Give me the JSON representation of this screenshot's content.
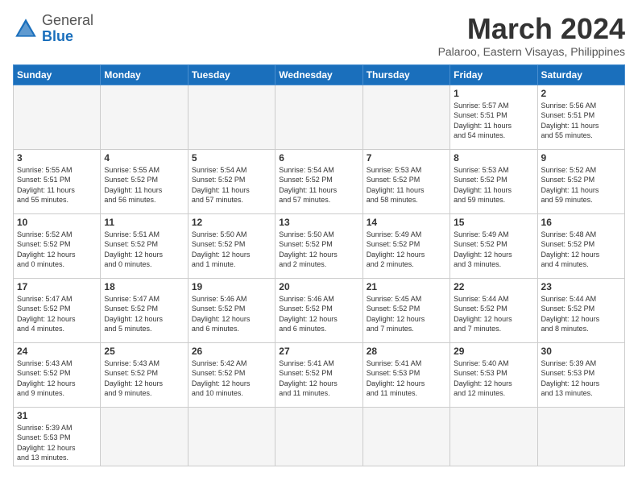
{
  "header": {
    "logo_general": "General",
    "logo_blue": "Blue",
    "title": "March 2024",
    "subtitle": "Palaroo, Eastern Visayas, Philippines"
  },
  "weekdays": [
    "Sunday",
    "Monday",
    "Tuesday",
    "Wednesday",
    "Thursday",
    "Friday",
    "Saturday"
  ],
  "weeks": [
    [
      {
        "day": "",
        "info": ""
      },
      {
        "day": "",
        "info": ""
      },
      {
        "day": "",
        "info": ""
      },
      {
        "day": "",
        "info": ""
      },
      {
        "day": "",
        "info": ""
      },
      {
        "day": "1",
        "info": "Sunrise: 5:57 AM\nSunset: 5:51 PM\nDaylight: 11 hours\nand 54 minutes."
      },
      {
        "day": "2",
        "info": "Sunrise: 5:56 AM\nSunset: 5:51 PM\nDaylight: 11 hours\nand 55 minutes."
      }
    ],
    [
      {
        "day": "3",
        "info": "Sunrise: 5:55 AM\nSunset: 5:51 PM\nDaylight: 11 hours\nand 55 minutes."
      },
      {
        "day": "4",
        "info": "Sunrise: 5:55 AM\nSunset: 5:52 PM\nDaylight: 11 hours\nand 56 minutes."
      },
      {
        "day": "5",
        "info": "Sunrise: 5:54 AM\nSunset: 5:52 PM\nDaylight: 11 hours\nand 57 minutes."
      },
      {
        "day": "6",
        "info": "Sunrise: 5:54 AM\nSunset: 5:52 PM\nDaylight: 11 hours\nand 57 minutes."
      },
      {
        "day": "7",
        "info": "Sunrise: 5:53 AM\nSunset: 5:52 PM\nDaylight: 11 hours\nand 58 minutes."
      },
      {
        "day": "8",
        "info": "Sunrise: 5:53 AM\nSunset: 5:52 PM\nDaylight: 11 hours\nand 59 minutes."
      },
      {
        "day": "9",
        "info": "Sunrise: 5:52 AM\nSunset: 5:52 PM\nDaylight: 11 hours\nand 59 minutes."
      }
    ],
    [
      {
        "day": "10",
        "info": "Sunrise: 5:52 AM\nSunset: 5:52 PM\nDaylight: 12 hours\nand 0 minutes."
      },
      {
        "day": "11",
        "info": "Sunrise: 5:51 AM\nSunset: 5:52 PM\nDaylight: 12 hours\nand 0 minutes."
      },
      {
        "day": "12",
        "info": "Sunrise: 5:50 AM\nSunset: 5:52 PM\nDaylight: 12 hours\nand 1 minute."
      },
      {
        "day": "13",
        "info": "Sunrise: 5:50 AM\nSunset: 5:52 PM\nDaylight: 12 hours\nand 2 minutes."
      },
      {
        "day": "14",
        "info": "Sunrise: 5:49 AM\nSunset: 5:52 PM\nDaylight: 12 hours\nand 2 minutes."
      },
      {
        "day": "15",
        "info": "Sunrise: 5:49 AM\nSunset: 5:52 PM\nDaylight: 12 hours\nand 3 minutes."
      },
      {
        "day": "16",
        "info": "Sunrise: 5:48 AM\nSunset: 5:52 PM\nDaylight: 12 hours\nand 4 minutes."
      }
    ],
    [
      {
        "day": "17",
        "info": "Sunrise: 5:47 AM\nSunset: 5:52 PM\nDaylight: 12 hours\nand 4 minutes."
      },
      {
        "day": "18",
        "info": "Sunrise: 5:47 AM\nSunset: 5:52 PM\nDaylight: 12 hours\nand 5 minutes."
      },
      {
        "day": "19",
        "info": "Sunrise: 5:46 AM\nSunset: 5:52 PM\nDaylight: 12 hours\nand 6 minutes."
      },
      {
        "day": "20",
        "info": "Sunrise: 5:46 AM\nSunset: 5:52 PM\nDaylight: 12 hours\nand 6 minutes."
      },
      {
        "day": "21",
        "info": "Sunrise: 5:45 AM\nSunset: 5:52 PM\nDaylight: 12 hours\nand 7 minutes."
      },
      {
        "day": "22",
        "info": "Sunrise: 5:44 AM\nSunset: 5:52 PM\nDaylight: 12 hours\nand 7 minutes."
      },
      {
        "day": "23",
        "info": "Sunrise: 5:44 AM\nSunset: 5:52 PM\nDaylight: 12 hours\nand 8 minutes."
      }
    ],
    [
      {
        "day": "24",
        "info": "Sunrise: 5:43 AM\nSunset: 5:52 PM\nDaylight: 12 hours\nand 9 minutes."
      },
      {
        "day": "25",
        "info": "Sunrise: 5:43 AM\nSunset: 5:52 PM\nDaylight: 12 hours\nand 9 minutes."
      },
      {
        "day": "26",
        "info": "Sunrise: 5:42 AM\nSunset: 5:52 PM\nDaylight: 12 hours\nand 10 minutes."
      },
      {
        "day": "27",
        "info": "Sunrise: 5:41 AM\nSunset: 5:52 PM\nDaylight: 12 hours\nand 11 minutes."
      },
      {
        "day": "28",
        "info": "Sunrise: 5:41 AM\nSunset: 5:53 PM\nDaylight: 12 hours\nand 11 minutes."
      },
      {
        "day": "29",
        "info": "Sunrise: 5:40 AM\nSunset: 5:53 PM\nDaylight: 12 hours\nand 12 minutes."
      },
      {
        "day": "30",
        "info": "Sunrise: 5:39 AM\nSunset: 5:53 PM\nDaylight: 12 hours\nand 13 minutes."
      }
    ],
    [
      {
        "day": "31",
        "info": "Sunrise: 5:39 AM\nSunset: 5:53 PM\nDaylight: 12 hours\nand 13 minutes."
      },
      {
        "day": "",
        "info": ""
      },
      {
        "day": "",
        "info": ""
      },
      {
        "day": "",
        "info": ""
      },
      {
        "day": "",
        "info": ""
      },
      {
        "day": "",
        "info": ""
      },
      {
        "day": "",
        "info": ""
      }
    ]
  ]
}
